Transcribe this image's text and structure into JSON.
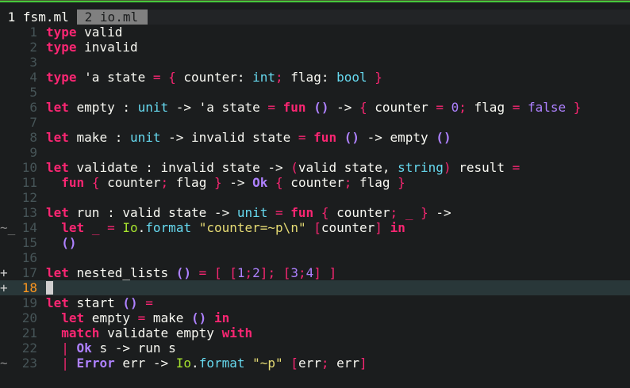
{
  "tabs": [
    {
      "number": "1",
      "name": "fsm.ml",
      "active": true
    },
    {
      "number": "2",
      "name": "io.ml",
      "active": false
    }
  ],
  "colors": {
    "background": "#1b1d1e",
    "keyword": "#f92672",
    "type": "#66d9ef",
    "number": "#ae81ff",
    "string": "#e6db74",
    "module": "#a6e22e",
    "current_line_number": "#fd971f",
    "line_number": "#465457",
    "top_bar": "#46c83c"
  },
  "editor": {
    "current_line": 18,
    "lines": [
      {
        "n": "1",
        "sign": "",
        "tokens": [
          [
            "k",
            "type"
          ],
          [
            "p",
            " valid"
          ]
        ]
      },
      {
        "n": "2",
        "sign": "",
        "tokens": [
          [
            "k",
            "type"
          ],
          [
            "p",
            " invalid"
          ]
        ]
      },
      {
        "n": "3",
        "sign": "",
        "tokens": []
      },
      {
        "n": "4",
        "sign": "",
        "tokens": [
          [
            "k",
            "type"
          ],
          [
            "p",
            " 'a state "
          ],
          [
            "o",
            "="
          ],
          [
            "p",
            " "
          ],
          [
            "o",
            "{"
          ],
          [
            "p",
            " counter: "
          ],
          [
            "t",
            "int"
          ],
          [
            "o",
            ";"
          ],
          [
            "p",
            " flag: "
          ],
          [
            "t",
            "bool"
          ],
          [
            "p",
            " "
          ],
          [
            "o",
            "}"
          ]
        ]
      },
      {
        "n": "5",
        "sign": "",
        "tokens": []
      },
      {
        "n": "6",
        "sign": "",
        "tokens": [
          [
            "k",
            "let"
          ],
          [
            "p",
            " empty : "
          ],
          [
            "t",
            "unit"
          ],
          [
            "p",
            " -> 'a state "
          ],
          [
            "o",
            "="
          ],
          [
            "p",
            " "
          ],
          [
            "k",
            "fun"
          ],
          [
            "p",
            " "
          ],
          [
            "c",
            "()"
          ],
          [
            "p",
            " -> "
          ],
          [
            "o",
            "{"
          ],
          [
            "p",
            " counter "
          ],
          [
            "o",
            "="
          ],
          [
            "p",
            " "
          ],
          [
            "n",
            "0"
          ],
          [
            "o",
            ";"
          ],
          [
            "p",
            " flag "
          ],
          [
            "o",
            "="
          ],
          [
            "p",
            " "
          ],
          [
            "n",
            "false"
          ],
          [
            "p",
            " "
          ],
          [
            "o",
            "}"
          ]
        ]
      },
      {
        "n": "7",
        "sign": "",
        "tokens": []
      },
      {
        "n": "8",
        "sign": "",
        "tokens": [
          [
            "k",
            "let"
          ],
          [
            "p",
            " make : "
          ],
          [
            "t",
            "unit"
          ],
          [
            "p",
            " -> invalid state "
          ],
          [
            "o",
            "="
          ],
          [
            "p",
            " "
          ],
          [
            "k",
            "fun"
          ],
          [
            "p",
            " "
          ],
          [
            "c",
            "()"
          ],
          [
            "p",
            " -> empty "
          ],
          [
            "c",
            "()"
          ]
        ]
      },
      {
        "n": "9",
        "sign": "",
        "tokens": []
      },
      {
        "n": "10",
        "sign": "",
        "tokens": [
          [
            "k",
            "let"
          ],
          [
            "p",
            " validate : invalid state -> "
          ],
          [
            "o",
            "("
          ],
          [
            "p",
            "valid state, "
          ],
          [
            "t",
            "string"
          ],
          [
            "o",
            ")"
          ],
          [
            "p",
            " result "
          ],
          [
            "o",
            "="
          ]
        ]
      },
      {
        "n": "11",
        "sign": "",
        "tokens": [
          [
            "p",
            "  "
          ],
          [
            "k",
            "fun"
          ],
          [
            "p",
            " "
          ],
          [
            "o",
            "{"
          ],
          [
            "p",
            " counter"
          ],
          [
            "o",
            ";"
          ],
          [
            "p",
            " flag "
          ],
          [
            "o",
            "}"
          ],
          [
            "p",
            " -> "
          ],
          [
            "c",
            "Ok"
          ],
          [
            "p",
            " "
          ],
          [
            "o",
            "{"
          ],
          [
            "p",
            " counter"
          ],
          [
            "o",
            ";"
          ],
          [
            "p",
            " flag "
          ],
          [
            "o",
            "}"
          ]
        ]
      },
      {
        "n": "12",
        "sign": "",
        "tokens": []
      },
      {
        "n": "13",
        "sign": "",
        "tokens": [
          [
            "k",
            "let"
          ],
          [
            "p",
            " run : valid state -> "
          ],
          [
            "t",
            "unit"
          ],
          [
            "p",
            " "
          ],
          [
            "o",
            "="
          ],
          [
            "p",
            " "
          ],
          [
            "k",
            "fun"
          ],
          [
            "p",
            " "
          ],
          [
            "o",
            "{"
          ],
          [
            "p",
            " counter"
          ],
          [
            "o",
            ";"
          ],
          [
            "p",
            " "
          ],
          [
            "o",
            "_"
          ],
          [
            "p",
            " "
          ],
          [
            "o",
            "}"
          ],
          [
            "p",
            " ->"
          ]
        ]
      },
      {
        "n": "14",
        "sign": "~_",
        "tokens": [
          [
            "p",
            "  "
          ],
          [
            "k",
            "let"
          ],
          [
            "p",
            " "
          ],
          [
            "o",
            "_"
          ],
          [
            "p",
            " "
          ],
          [
            "o",
            "="
          ],
          [
            "p",
            " "
          ],
          [
            "m",
            "Io"
          ],
          [
            "p",
            "."
          ],
          [
            "t",
            "format"
          ],
          [
            "p",
            " "
          ],
          [
            "s",
            "\"counter=~p\\n\""
          ],
          [
            "p",
            " "
          ],
          [
            "o",
            "["
          ],
          [
            "p",
            "counter"
          ],
          [
            "o",
            "]"
          ],
          [
            "p",
            " "
          ],
          [
            "k",
            "in"
          ]
        ]
      },
      {
        "n": "15",
        "sign": "",
        "tokens": [
          [
            "p",
            "  "
          ],
          [
            "c",
            "()"
          ]
        ]
      },
      {
        "n": "16",
        "sign": "",
        "tokens": []
      },
      {
        "n": "17",
        "sign": "+",
        "tokens": [
          [
            "k",
            "let"
          ],
          [
            "p",
            " nested_lists "
          ],
          [
            "c",
            "()"
          ],
          [
            "p",
            " "
          ],
          [
            "o",
            "="
          ],
          [
            "p",
            " "
          ],
          [
            "o",
            "["
          ],
          [
            "p",
            " "
          ],
          [
            "o",
            "["
          ],
          [
            "n",
            "1"
          ],
          [
            "o",
            ";"
          ],
          [
            "n",
            "2"
          ],
          [
            "o",
            "]"
          ],
          [
            "o",
            ";"
          ],
          [
            "p",
            " "
          ],
          [
            "o",
            "["
          ],
          [
            "n",
            "3"
          ],
          [
            "o",
            ";"
          ],
          [
            "n",
            "4"
          ],
          [
            "o",
            "]"
          ],
          [
            "p",
            " "
          ],
          [
            "o",
            "]"
          ]
        ]
      },
      {
        "n": "18",
        "sign": "+",
        "tokens": []
      },
      {
        "n": "19",
        "sign": "",
        "tokens": [
          [
            "k",
            "let"
          ],
          [
            "p",
            " start "
          ],
          [
            "c",
            "()"
          ],
          [
            "p",
            " "
          ],
          [
            "o",
            "="
          ]
        ]
      },
      {
        "n": "20",
        "sign": "",
        "tokens": [
          [
            "p",
            "  "
          ],
          [
            "k",
            "let"
          ],
          [
            "p",
            " empty "
          ],
          [
            "o",
            "="
          ],
          [
            "p",
            " make "
          ],
          [
            "c",
            "()"
          ],
          [
            "p",
            " "
          ],
          [
            "k",
            "in"
          ]
        ]
      },
      {
        "n": "21",
        "sign": "",
        "tokens": [
          [
            "p",
            "  "
          ],
          [
            "k",
            "match"
          ],
          [
            "p",
            " validate empty "
          ],
          [
            "k",
            "with"
          ]
        ]
      },
      {
        "n": "22",
        "sign": "",
        "tokens": [
          [
            "p",
            "  "
          ],
          [
            "o",
            "|"
          ],
          [
            "p",
            " "
          ],
          [
            "c",
            "Ok"
          ],
          [
            "p",
            " s -> run s"
          ]
        ]
      },
      {
        "n": "23",
        "sign": "~",
        "tokens": [
          [
            "p",
            "  "
          ],
          [
            "o",
            "|"
          ],
          [
            "p",
            " "
          ],
          [
            "c",
            "Error"
          ],
          [
            "p",
            " err -> "
          ],
          [
            "m",
            "Io"
          ],
          [
            "p",
            "."
          ],
          [
            "t",
            "format"
          ],
          [
            "p",
            " "
          ],
          [
            "s",
            "\"~p\""
          ],
          [
            "p",
            " "
          ],
          [
            "o",
            "["
          ],
          [
            "p",
            "err"
          ],
          [
            "o",
            ";"
          ],
          [
            "p",
            " err"
          ],
          [
            "o",
            "]"
          ]
        ]
      }
    ]
  }
}
